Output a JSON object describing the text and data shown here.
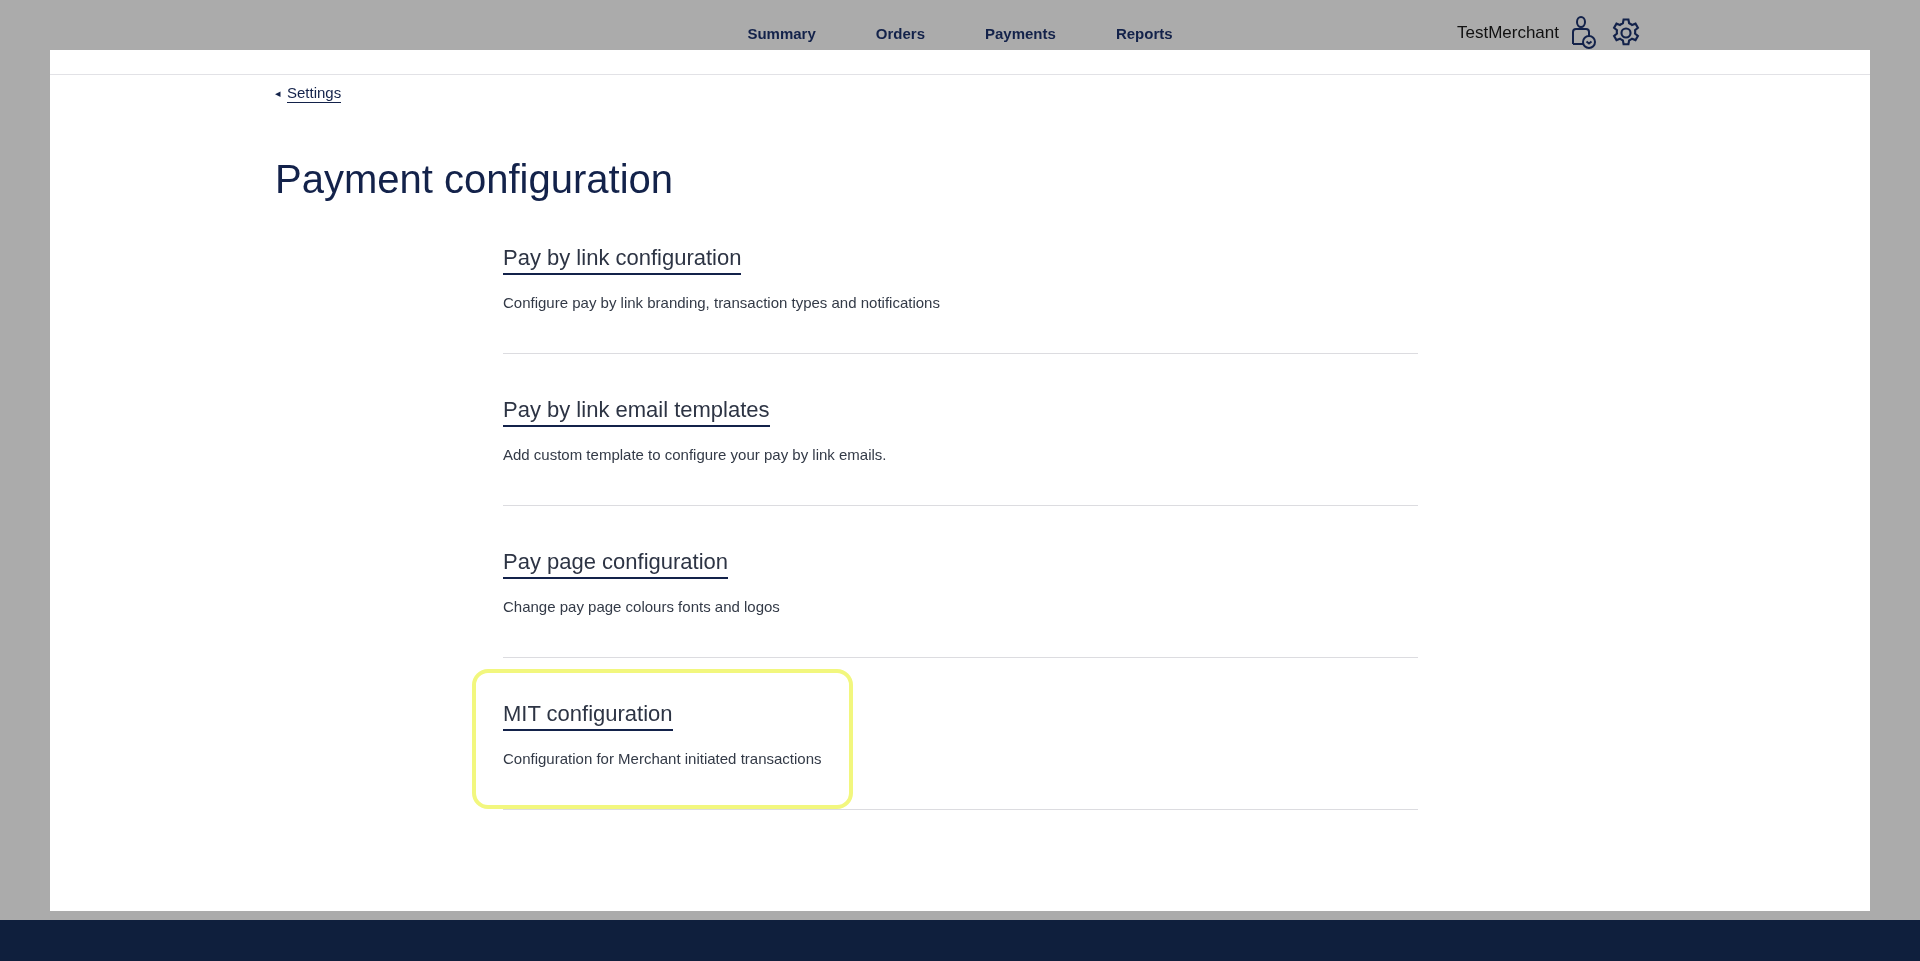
{
  "nav": [
    {
      "label": "Summary"
    },
    {
      "label": "Orders"
    },
    {
      "label": "Payments"
    },
    {
      "label": "Reports"
    }
  ],
  "user": {
    "name": "TestMerchant"
  },
  "back_link": {
    "icon": "◂",
    "label": "Settings"
  },
  "page_title": "Payment configuration",
  "items": [
    {
      "title": "Pay by link configuration",
      "description": "Configure pay by link branding, transaction types and notifications",
      "highlighted": false
    },
    {
      "title": "Pay by link email templates",
      "description": "Add custom template to configure your pay by link emails.",
      "highlighted": false
    },
    {
      "title": "Pay page configuration",
      "description": "Change pay page colours fonts and logos",
      "highlighted": false
    },
    {
      "title": "MIT configuration",
      "description": "Configuration for Merchant initiated transactions",
      "highlighted": true
    }
  ]
}
